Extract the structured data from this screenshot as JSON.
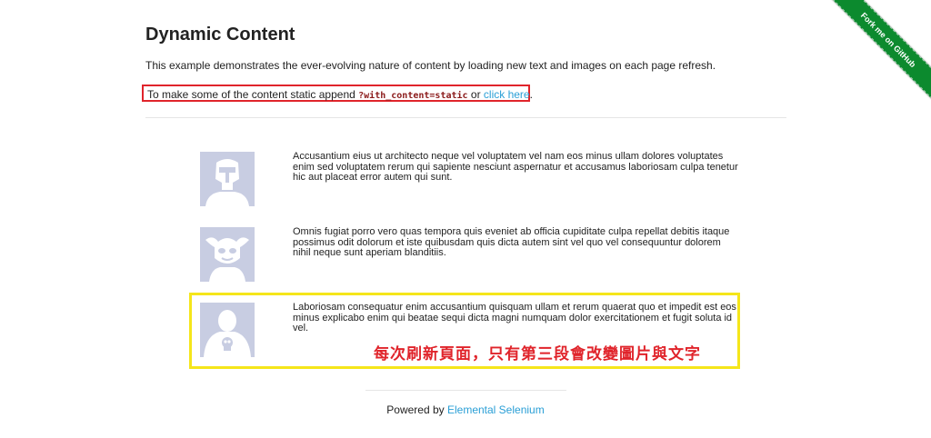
{
  "header": {
    "title": "Dynamic Content",
    "description": "This example demonstrates the ever-evolving nature of content by loading new text and images on each page refresh."
  },
  "static_hint": {
    "prefix": "To make some of the content static append ",
    "code": "?with_content=static",
    "or_text": " or ",
    "link_text": "click here",
    "suffix": "."
  },
  "rows": [
    {
      "avatar_icon": "boba-fett-avatar-icon",
      "text": "Accusantium eius ut architecto neque vel voluptatem vel nam eos minus ullam dolores voluptates enim sed voluptatem rerum qui sapiente nesciunt aspernatur et accusamus laboriosam culpa tenetur hic aut placeat error autem qui sunt."
    },
    {
      "avatar_icon": "jester-mask-avatar-icon",
      "text": "Omnis fugiat porro vero quas tempora quis eveniet ab officia cupiditate culpa repellat debitis itaque possimus odit dolorum et iste quibusdam quis dicta autem sint vel quo vel consequuntur dolorem nihil neque sunt aperiam blanditiis."
    },
    {
      "avatar_icon": "punisher-avatar-icon",
      "text": "Laboriosam consequatur enim accusantium quisquam ullam et rerum quaerat quo et impedit est eos minus explicabo enim qui beatae sequi dicta magni numquam dolor exercitationem et fugit soluta id vel."
    }
  ],
  "annotation": "每次刷新頁面，只有第三段會改變圖片與文字",
  "footer": {
    "prefix": "Powered by ",
    "link_text": "Elemental Selenium"
  },
  "ribbon": {
    "text": "Fork me on GitHub"
  },
  "colors": {
    "link": "#2a9fd6",
    "red_box": "#e0242b",
    "yellow_box": "#f5e61a",
    "ribbon": "#0c8a2e",
    "avatar_bg": "#c8cde2"
  }
}
